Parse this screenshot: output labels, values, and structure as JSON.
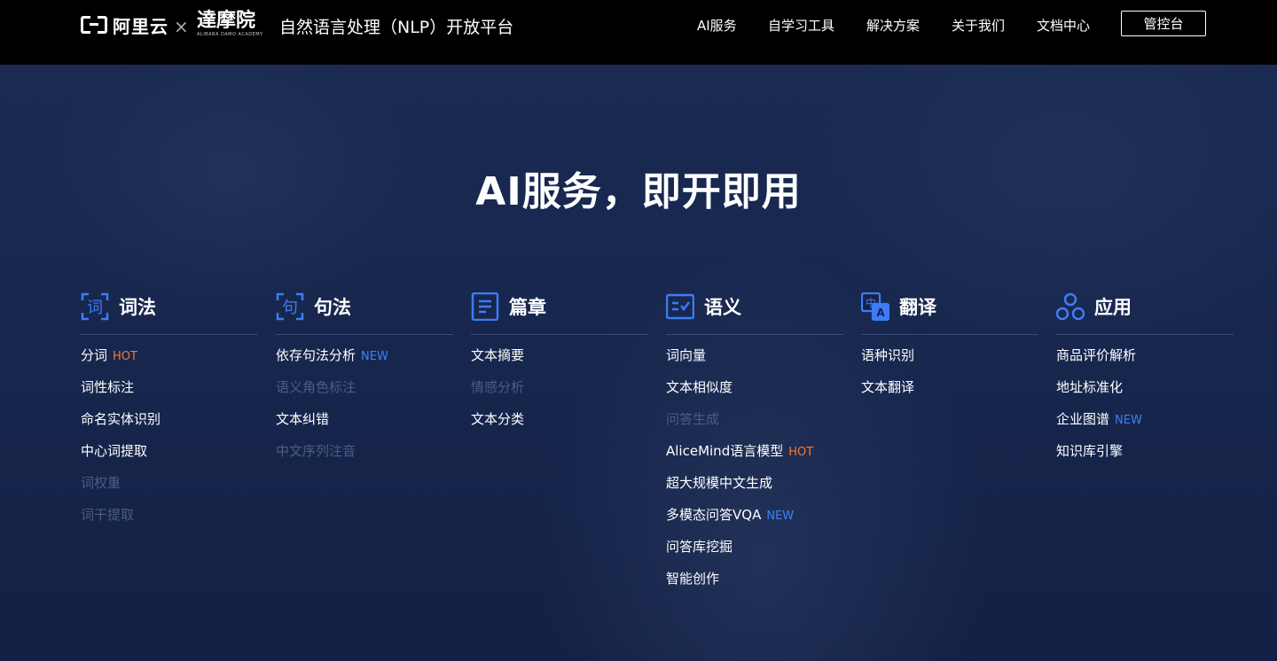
{
  "header": {
    "brand_aliyun": "阿里云",
    "brand_separator": "×",
    "brand_damo": "達摩院",
    "brand_damo_sub": "ALIBABA DAMO ACADEMY",
    "site_title": "自然语言处理（NLP）开放平台",
    "nav": [
      "AI服务",
      "自学习工具",
      "解决方案",
      "关于我们",
      "文档中心"
    ],
    "console_label": "管控台"
  },
  "hero": {
    "headline": "AI服务，即开即用"
  },
  "colors": {
    "hot": "#f37b37",
    "new": "#3b82f6",
    "icon_blue": "#3d7df5",
    "background": "#16244a"
  },
  "categories": [
    {
      "icon": "lexical-icon",
      "icon_char": "词",
      "title": "词法",
      "items": [
        {
          "label": "分词",
          "badge": "HOT",
          "disabled": false
        },
        {
          "label": "词性标注",
          "badge": "",
          "disabled": false
        },
        {
          "label": "命名实体识别",
          "badge": "",
          "disabled": false
        },
        {
          "label": "中心词提取",
          "badge": "",
          "disabled": false
        },
        {
          "label": "词权重",
          "badge": "",
          "disabled": true
        },
        {
          "label": "词干提取",
          "badge": "",
          "disabled": true
        }
      ]
    },
    {
      "icon": "syntax-icon",
      "icon_char": "句",
      "title": "句法",
      "items": [
        {
          "label": "依存句法分析",
          "badge": "NEW",
          "disabled": false
        },
        {
          "label": "语义角色标注",
          "badge": "",
          "disabled": true
        },
        {
          "label": "文本纠错",
          "badge": "",
          "disabled": false
        },
        {
          "label": "中文序列注音",
          "badge": "",
          "disabled": true
        }
      ]
    },
    {
      "icon": "document-icon",
      "icon_char": "",
      "title": "篇章",
      "items": [
        {
          "label": "文本摘要",
          "badge": "",
          "disabled": false
        },
        {
          "label": "情感分析",
          "badge": "",
          "disabled": true
        },
        {
          "label": "文本分类",
          "badge": "",
          "disabled": false
        }
      ]
    },
    {
      "icon": "semantic-icon",
      "icon_char": "",
      "title": "语义",
      "items": [
        {
          "label": "词向量",
          "badge": "",
          "disabled": false
        },
        {
          "label": "文本相似度",
          "badge": "",
          "disabled": false
        },
        {
          "label": "问答生成",
          "badge": "",
          "disabled": true
        },
        {
          "label": "AliceMind语言模型",
          "badge": "HOT",
          "disabled": false
        },
        {
          "label": "超大规模中文生成",
          "badge": "",
          "disabled": false
        },
        {
          "label": "多模态问答VQA",
          "badge": "NEW",
          "disabled": false
        },
        {
          "label": "问答库挖掘",
          "badge": "",
          "disabled": false
        },
        {
          "label": "智能创作",
          "badge": "",
          "disabled": false
        }
      ]
    },
    {
      "icon": "translate-icon",
      "icon_char": "中",
      "title": "翻译",
      "items": [
        {
          "label": "语种识别",
          "badge": "",
          "disabled": false
        },
        {
          "label": "文本翻译",
          "badge": "",
          "disabled": false
        }
      ]
    },
    {
      "icon": "application-icon",
      "icon_char": "",
      "title": "应用",
      "items": [
        {
          "label": "商品评价解析",
          "badge": "",
          "disabled": false
        },
        {
          "label": "地址标准化",
          "badge": "",
          "disabled": false
        },
        {
          "label": "企业图谱",
          "badge": "NEW",
          "disabled": false
        },
        {
          "label": "知识库引擎",
          "badge": "",
          "disabled": false
        }
      ]
    }
  ]
}
